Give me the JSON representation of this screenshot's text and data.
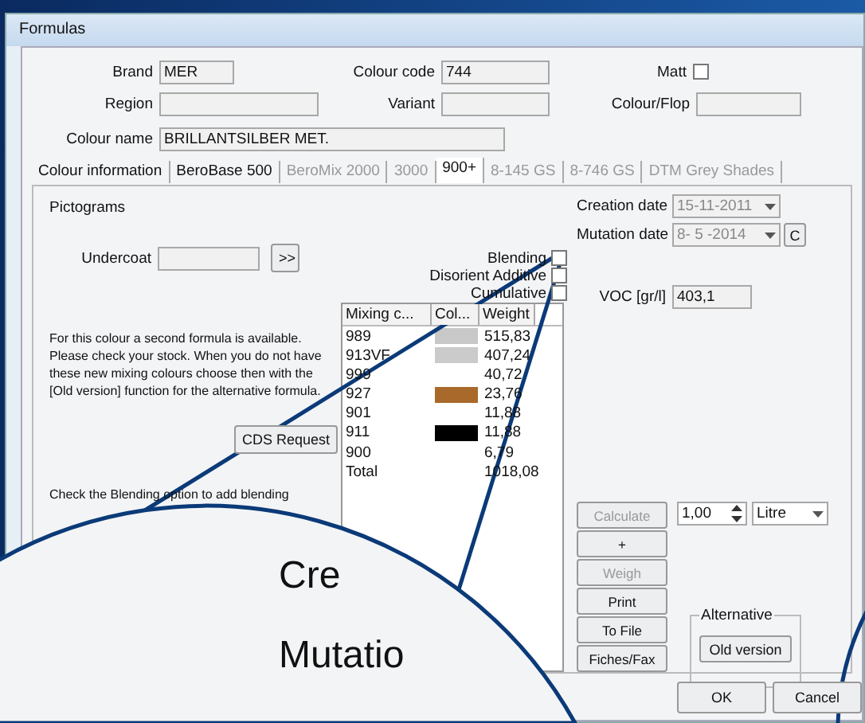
{
  "window": {
    "title": "Formulas"
  },
  "header": {
    "brand": {
      "label": "Brand",
      "value": "MER"
    },
    "colour_code": {
      "label": "Colour code",
      "value": "744"
    },
    "matt": {
      "label": "Matt",
      "checked": false
    },
    "region": {
      "label": "Region"
    },
    "variant": {
      "label": "Variant"
    },
    "colour_flop": {
      "label": "Colour/Flop"
    },
    "colour_name": {
      "label": "Colour name",
      "value": "BRILLANTSILBER MET."
    }
  },
  "tabs": [
    {
      "label": "Colour information",
      "selected": false,
      "disabled": false
    },
    {
      "label": "BeroBase 500",
      "selected": false,
      "disabled": false
    },
    {
      "label": "BeroMix 2000",
      "selected": false,
      "disabled": true
    },
    {
      "label": "3000",
      "selected": false,
      "disabled": true
    },
    {
      "label": "900+",
      "selected": true,
      "disabled": false
    },
    {
      "label": "8-145 GS",
      "selected": false,
      "disabled": true
    },
    {
      "label": "8-746 GS",
      "selected": false,
      "disabled": true
    },
    {
      "label": "DTM Grey Shades",
      "selected": false,
      "disabled": true
    }
  ],
  "panel": {
    "pictograms": "Pictograms",
    "undercoat": {
      "label": "Undercoat",
      "button": ">>"
    },
    "options": [
      {
        "label": "Blending",
        "checked": false
      },
      {
        "label": "Disorient Additive",
        "checked": false
      },
      {
        "label": "Cumulative",
        "checked": false
      }
    ],
    "info_text": "For this colour a second formula is available. Please check your stock. When you do not have these new mixing colours choose then with the [Old version] function for the alternative formula.",
    "cds_button": "CDS Request",
    "note_text": "Check the Blending option to add blending",
    "grid": {
      "columns": [
        "Mixing c...",
        "Col...",
        "Weight"
      ],
      "rows": [
        {
          "code": "989",
          "color": "#c8c8c8",
          "weight": "515,83"
        },
        {
          "code": "913VF",
          "color": "#cbcbcb",
          "weight": "407,24"
        },
        {
          "code": "999",
          "weight": "40,72"
        },
        {
          "code": "927",
          "color": "#a8692a",
          "weight": "23,76"
        },
        {
          "code": "901",
          "weight": "11,88"
        },
        {
          "code": "911",
          "color": "#000000",
          "weight": "11,88"
        },
        {
          "code": "900",
          "weight": "6,79"
        },
        {
          "code": "Total",
          "weight": "1018,08"
        }
      ]
    },
    "creation_date": {
      "label": "Creation date",
      "value": "15-11-2011"
    },
    "mutation_date": {
      "label": "Mutation date",
      "value": "8- 5 -2014",
      "button": "C"
    },
    "voc": {
      "label": "VOC [gr/l]",
      "value": "403,1"
    },
    "actions": [
      {
        "label": "Calculate",
        "disabled": true
      },
      {
        "label": "+",
        "disabled": false
      },
      {
        "label": "Weigh",
        "disabled": true
      },
      {
        "label": "Print",
        "disabled": false
      },
      {
        "label": "To File",
        "disabled": false
      },
      {
        "label": "Fiches/Fax",
        "disabled": false
      }
    ],
    "quantity": "1,00",
    "unit": "Litre",
    "alternative": {
      "title": "Alternative",
      "button": "Old version"
    }
  },
  "footer": {
    "buttons": [
      "OK",
      "Cancel"
    ]
  },
  "magnifier": {
    "texts": [
      "Cre",
      "Mutatio"
    ]
  }
}
